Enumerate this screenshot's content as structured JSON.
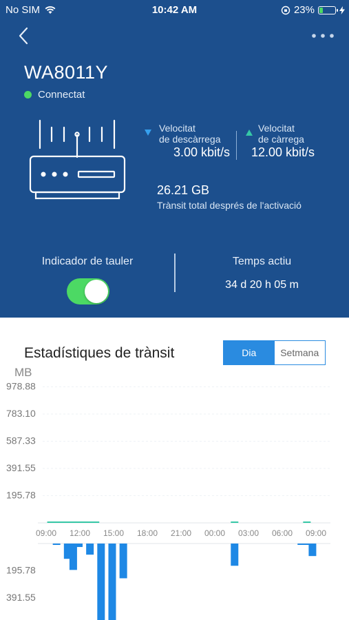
{
  "status_bar": {
    "carrier": "No SIM",
    "time": "10:42 AM",
    "battery_pct": "23%",
    "battery_level": 0.23
  },
  "header": {
    "device_name": "WA8011Y",
    "connection_status": "Connectat"
  },
  "speeds": {
    "download_label_1": "Velocitat",
    "download_label_2": "de descàrrega",
    "download_value": "3.00 kbit/s",
    "upload_label_1": "Velocitat",
    "upload_label_2": "de càrrega",
    "upload_value": "12.00 kbit/s"
  },
  "traffic": {
    "total_value": "26.21 GB",
    "total_label": "Trànsit total després de l'activació"
  },
  "panel": {
    "indicator_label": "Indicador de tauler",
    "indicator_on": true,
    "uptime_label": "Temps actiu",
    "uptime_value": "34 d 20 h 05 m"
  },
  "stats": {
    "title": "Estadístiques de trànsit",
    "tab_day": "Dia",
    "tab_week": "Setmana",
    "active_tab": "Dia"
  },
  "colors": {
    "header_bg": "#1c4f8d",
    "accent": "#2a8be0",
    "download_bar": "#1e88e5",
    "upload_bar": "#36c8a6",
    "online": "#4cd964"
  },
  "chart_data": {
    "type": "bar",
    "ylabel": "MB",
    "y_ticks_upper": [
      "978.88",
      "783.10",
      "587.33",
      "391.55",
      "195.78"
    ],
    "y_ticks_lower": [
      "195.78",
      "391.55"
    ],
    "x_ticks": [
      "09:00",
      "12:00",
      "15:00",
      "18:00",
      "21:00",
      "00:00",
      "03:00",
      "06:00",
      "09:00"
    ],
    "series": [
      {
        "direction": "upload",
        "values": [
          0,
          5,
          5,
          5,
          5,
          10,
          10,
          10,
          5,
          5,
          0,
          0,
          0,
          0,
          0,
          0,
          0,
          0,
          0,
          0,
          0,
          0,
          0,
          0,
          0,
          0,
          0,
          0,
          0,
          0,
          0,
          0,
          0,
          0,
          5,
          0,
          0,
          0,
          0,
          0,
          0,
          0,
          0,
          0,
          0,
          0,
          0,
          5,
          0,
          0
        ]
      },
      {
        "direction": "download",
        "values": [
          0,
          0,
          10,
          0,
          110,
          190,
          25,
          0,
          80,
          0,
          560,
          0,
          560,
          0,
          250,
          0,
          0,
          0,
          0,
          0,
          0,
          0,
          0,
          0,
          0,
          0,
          0,
          0,
          0,
          0,
          0,
          0,
          0,
          0,
          160,
          0,
          0,
          0,
          0,
          0,
          0,
          0,
          0,
          0,
          0,
          0,
          5,
          5,
          90,
          0
        ]
      }
    ]
  }
}
